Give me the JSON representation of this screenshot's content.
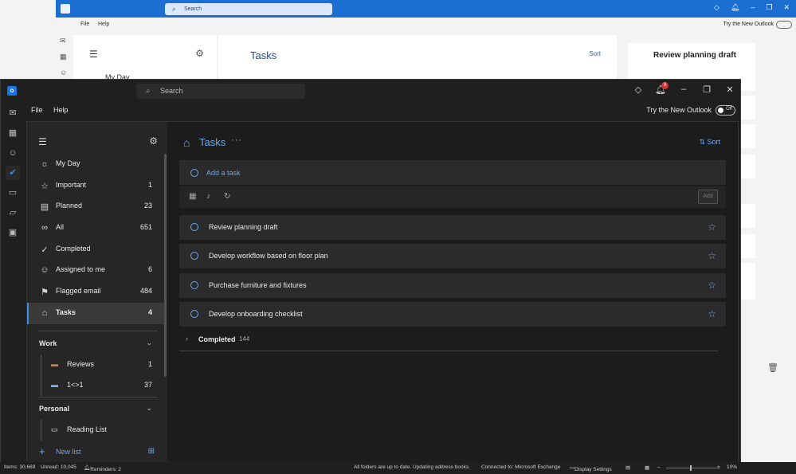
{
  "background_window": {
    "search_placeholder": "Search",
    "menu": [
      "File",
      "Help"
    ],
    "try_new": "Try the New Outlook",
    "sidebar_first_item": "My Day",
    "main_title": "Tasks",
    "sort_label": "Sort",
    "detail_title": "Review planning draft",
    "zoom": "10%"
  },
  "titlebar": {
    "search_placeholder": "Search",
    "notification_count": "9"
  },
  "menubar": {
    "file": "File",
    "help": "Help",
    "try_new": "Try the New Outlook",
    "toggle_label": "Off"
  },
  "sidebar": {
    "nav": [
      {
        "label": "My Day",
        "count": "",
        "icon": "sun-icon"
      },
      {
        "label": "Important",
        "count": "1",
        "icon": "star-icon"
      },
      {
        "label": "Planned",
        "count": "23",
        "icon": "calendar-icon"
      },
      {
        "label": "All",
        "count": "651",
        "icon": "infinity-icon"
      },
      {
        "label": "Completed",
        "count": "",
        "icon": "check-circle-icon"
      },
      {
        "label": "Assigned to me",
        "count": "6",
        "icon": "person-icon"
      },
      {
        "label": "Flagged email",
        "count": "484",
        "icon": "flag-icon"
      },
      {
        "label": "Tasks",
        "count": "4",
        "icon": "home-icon"
      }
    ],
    "groups": [
      {
        "label": "Work",
        "lists": [
          {
            "label": "Reviews",
            "count": "1",
            "icon": "briefcase-icon"
          },
          {
            "label": "1<>1",
            "count": "37",
            "icon": "card-icon"
          }
        ]
      },
      {
        "label": "Personal",
        "lists": [
          {
            "label": "Reading List",
            "count": "",
            "icon": "book-icon"
          }
        ]
      }
    ],
    "new_list": "New list"
  },
  "main": {
    "title": "Tasks",
    "sort_label": "Sort",
    "add_task_placeholder": "Add a task",
    "add_button": "Add",
    "tasks": [
      {
        "title": "Review planning draft"
      },
      {
        "title": "Develop workflow based on floor plan"
      },
      {
        "title": "Purchase furniture and fixtures"
      },
      {
        "title": "Develop onboarding checklist"
      }
    ],
    "completed_label": "Completed",
    "completed_count": "144"
  },
  "statusbar": {
    "items": "Items: 30,669",
    "unread": "Unread: 10,045",
    "reminders": "Reminders: 2",
    "folders_status": "All folders are up to date.",
    "updating": "Updating address books.",
    "connected": "Connected to: Microsoft Exchange",
    "display_settings": "Display Settings",
    "zoom": "10%"
  },
  "colors": {
    "accent": "#6aa7f0",
    "titlebar_bg": "#1f1f1f",
    "badge": "#d13438",
    "light_titlebar": "#1c6fd1"
  }
}
